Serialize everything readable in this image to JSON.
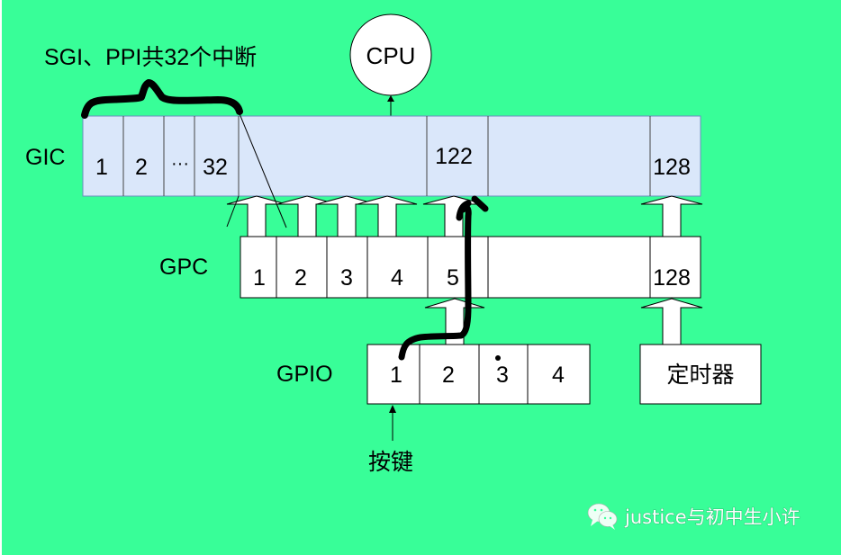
{
  "colors": {
    "background": "#38fe98",
    "gic_fill": "#dae7fa",
    "box_fill": "#ffffff",
    "stroke": "#000000",
    "annotation": "#000000"
  },
  "annotation": {
    "brace_label": "SGI、PPI共32个中断"
  },
  "cpu": {
    "label": "CPU"
  },
  "gic": {
    "label": "GIC",
    "cells": [
      "1",
      "2",
      "···",
      "32",
      "",
      "122",
      "",
      "128"
    ]
  },
  "gpc": {
    "label": "GPC",
    "cells": [
      "1",
      "2",
      "3",
      "4",
      "5",
      "",
      "128"
    ]
  },
  "gpio": {
    "label": "GPIO",
    "cells": [
      "1",
      "2",
      "3",
      "4"
    ]
  },
  "timer": {
    "label": "定时器"
  },
  "key": {
    "label": "按键"
  },
  "watermark": {
    "icon": "wechat-icon",
    "text": "justice与初中生小许"
  }
}
